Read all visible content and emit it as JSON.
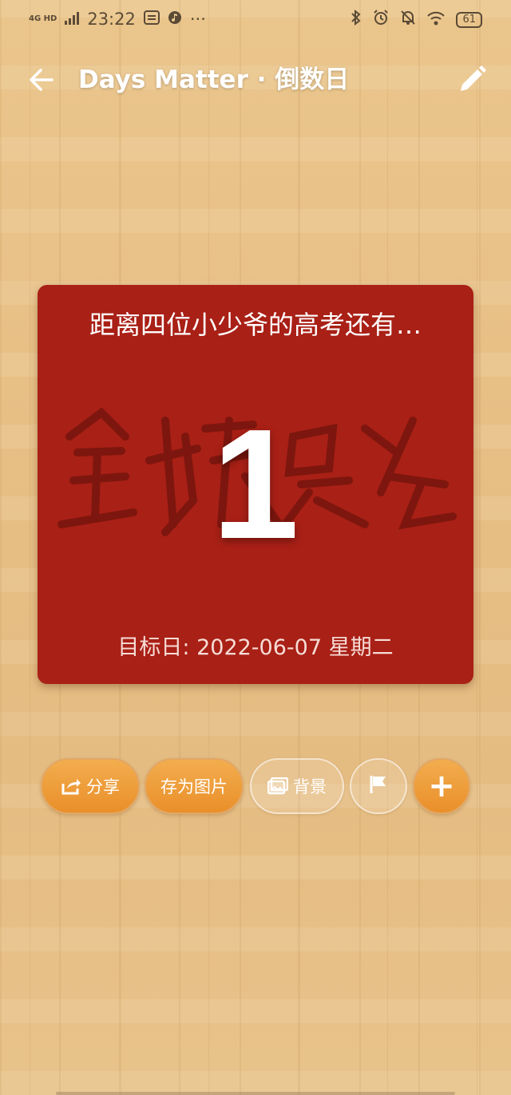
{
  "status_bar": {
    "network": "4G HD",
    "time": "23:22",
    "more": "···",
    "battery": "61"
  },
  "app_bar": {
    "title": "Days Matter · 倒数日",
    "back_icon": "arrow-left-icon",
    "edit_icon": "pencil-icon"
  },
  "card": {
    "title": "距离四位小少爷的高考还有…",
    "days": "1",
    "target_date": "目标日: 2022-06-07 星期二",
    "background_color": "#a92016",
    "background_art": "金榜题名"
  },
  "actions": {
    "share_label": "分享",
    "save_image_label": "存为图片",
    "background_label": "背景",
    "flag_icon": "flag-icon",
    "add_label": "+"
  },
  "colors": {
    "accent": "#ee9a35",
    "card": "#a92016"
  }
}
